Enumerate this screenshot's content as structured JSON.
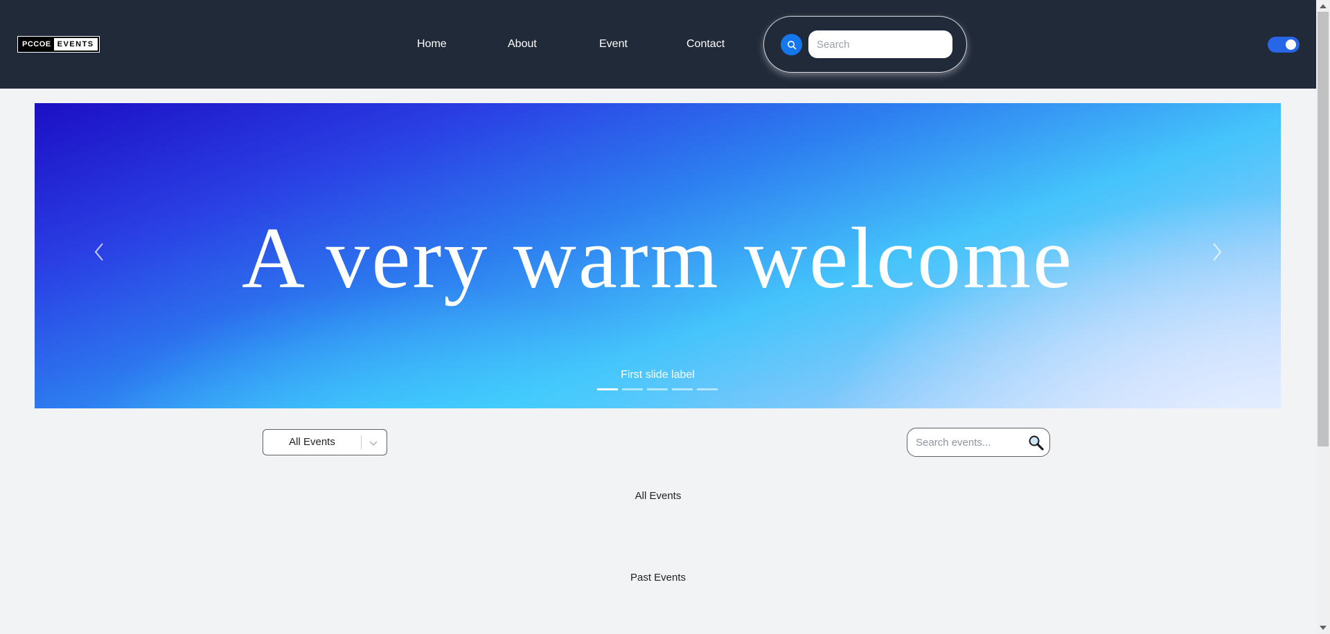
{
  "navbar": {
    "logo": {
      "part1": "PCCOE",
      "part2": "EVENTS"
    },
    "links": [
      {
        "label": "Home"
      },
      {
        "label": "About"
      },
      {
        "label": "Event"
      },
      {
        "label": "Contact"
      }
    ],
    "search": {
      "placeholder": "Search",
      "icon": "search-icon"
    },
    "theme_toggle": {
      "state": "on",
      "icon": "toggle-icon"
    }
  },
  "carousel": {
    "headline": "A very warm welcome",
    "slide_label": "First slide label",
    "active_slide_index": 0,
    "slides": [
      {
        "label": "First slide label"
      },
      {
        "label": ""
      },
      {
        "label": ""
      },
      {
        "label": ""
      },
      {
        "label": ""
      }
    ],
    "prev_icon": "chevron-left-icon",
    "next_icon": "chevron-right-icon"
  },
  "filters": {
    "category_select": {
      "value": "All Events",
      "icon": "chevron-down-icon"
    },
    "event_search": {
      "placeholder": "Search events...",
      "icon": "magnifier-icon"
    }
  },
  "sections": {
    "all_events": "All Events",
    "past_events": "Past Events"
  },
  "colors": {
    "navbar_bg": "#212a39",
    "accent_blue": "#1477ee",
    "toggle_blue": "#2866e8",
    "page_bg": "#f2f3f5"
  }
}
